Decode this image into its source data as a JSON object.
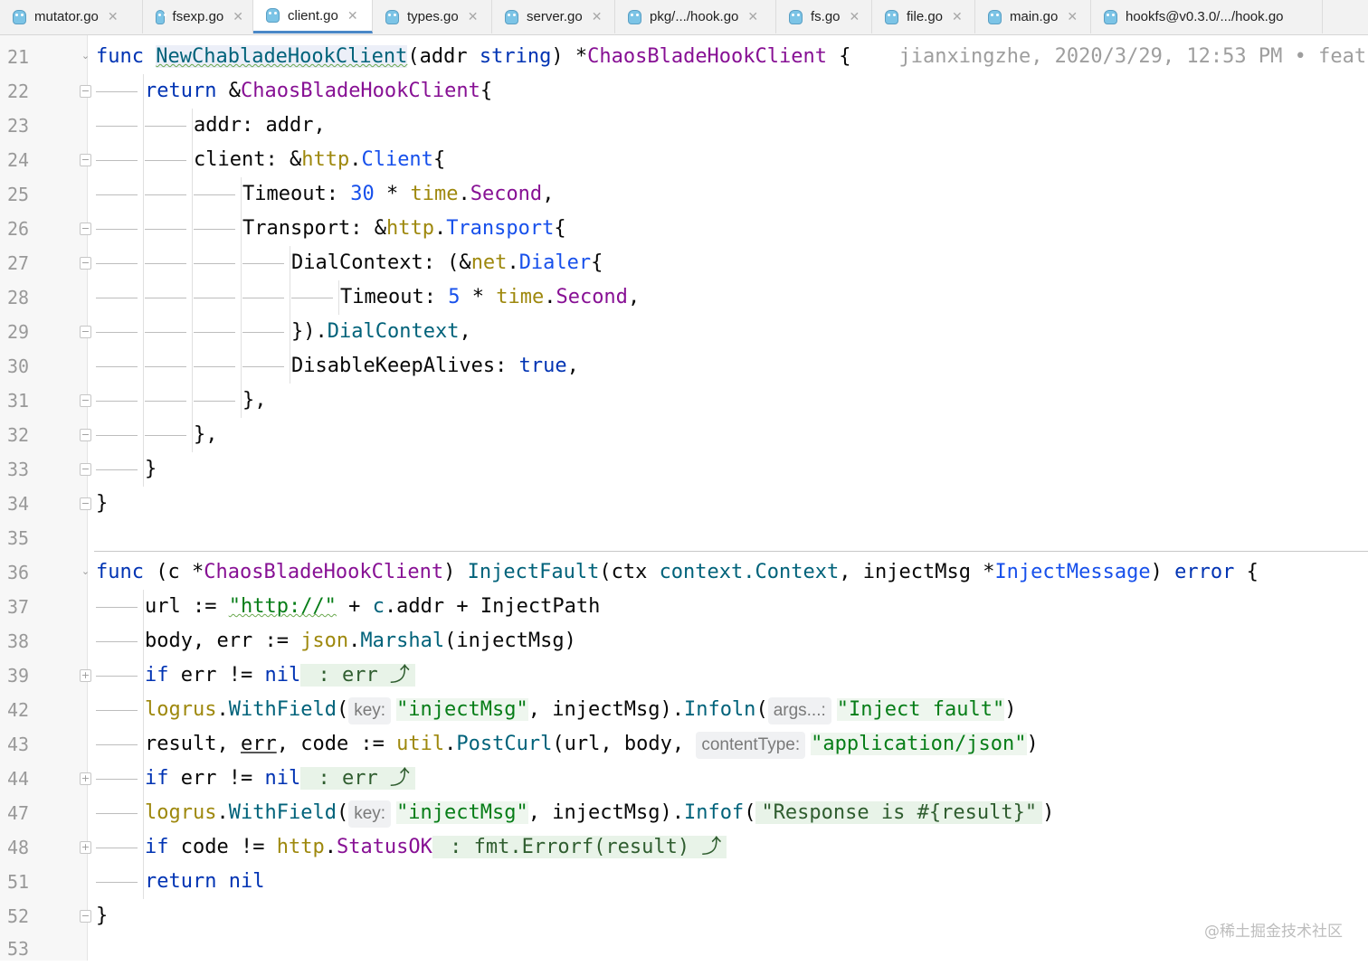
{
  "tabs": [
    {
      "label": "mutator.go",
      "active": false
    },
    {
      "label": "fsexp.go",
      "active": false
    },
    {
      "label": "client.go",
      "active": true
    },
    {
      "label": "types.go",
      "active": false
    },
    {
      "label": "server.go",
      "active": false
    },
    {
      "label": "pkg/.../hook.go",
      "active": false
    },
    {
      "label": "fs.go",
      "active": false
    },
    {
      "label": "file.go",
      "active": false
    },
    {
      "label": "main.go",
      "active": false
    },
    {
      "label": "hookfs@v0.3.0/.../hook.go",
      "active": false
    }
  ],
  "icons": {
    "tab_icon": "gopher-icon",
    "close": "close-icon",
    "fold": "fold-marker-icon"
  },
  "blame": "jianxingzhe, 2020/3/29, 12:53 PM • feat",
  "line_numbers": [
    "21",
    "22",
    "23",
    "24",
    "25",
    "26",
    "27",
    "28",
    "29",
    "30",
    "31",
    "32",
    "33",
    "34",
    "35",
    "36",
    "37",
    "38",
    "39",
    "42",
    "43",
    "44",
    "47",
    "48",
    "51",
    "52",
    "53"
  ],
  "code": {
    "l21": {
      "kw": "func",
      "name": "NewChabladeHookClient",
      "args": "(addr ",
      "argtype": "string",
      "rparen": ") *",
      "ret": "ChaosBladeHookClient",
      "brace": " {"
    },
    "l22": {
      "kw": "return",
      "amp": " &",
      "type": "ChaosBladeHookClient",
      "brace": "{"
    },
    "l23": {
      "text": "addr: addr,"
    },
    "l24": {
      "field": "client: &",
      "pkg": "http",
      "dot": ".",
      "type": "Client",
      "brace": "{"
    },
    "l25": {
      "field": "Timeout: ",
      "num": "30",
      "op": " * ",
      "pkg": "time",
      "dot": ".",
      "type": "Second",
      "comma": ","
    },
    "l26": {
      "field": "Transport: &",
      "pkg": "http",
      "dot": ".",
      "type": "Transport",
      "brace": "{"
    },
    "l27": {
      "field": "DialContext: (&",
      "pkg": "net",
      "dot": ".",
      "type": "Dialer",
      "brace": "{"
    },
    "l28": {
      "field": "Timeout: ",
      "num": "5",
      "op": " * ",
      "pkg": "time",
      "dot": ".",
      "type": "Second",
      "comma": ","
    },
    "l29": {
      "text": "}).",
      "method": "DialContext",
      "comma": ","
    },
    "l30": {
      "field": "DisableKeepAlives: ",
      "kw": "true",
      "comma": ","
    },
    "l31": {
      "text": "},"
    },
    "l32": {
      "text": "},"
    },
    "l33": {
      "text": "}"
    },
    "l34": {
      "text": "}"
    },
    "l36": {
      "kw": "func",
      "recv_open": " (c *",
      "recv_type": "ChaosBladeHookClient",
      "recv_close": ") ",
      "name": "InjectFault",
      "args": "(ctx ",
      "ctxtype": "context.Context",
      "sep": ", injectMsg *",
      "argtype": "InjectMessage",
      "rparen": ") ",
      "ret": "error",
      "brace": " {"
    },
    "l37": {
      "var": "url := ",
      "str": "\"http://\"",
      "rest1": " + ",
      "c": "c",
      "rest2": ".addr + InjectPath"
    },
    "l38": {
      "var": "body, err := ",
      "pkg": "json",
      "dot": ".",
      "method": "Marshal",
      "rest": "(injectMsg)"
    },
    "l39": {
      "kw": "if",
      "cond": " err != ",
      "nil": "nil",
      "fold": " : err ⤴"
    },
    "l42": {
      "pkg": "logrus",
      "dot": ".",
      "method": "WithField",
      "open": "(",
      "hint": "key:",
      "str": "\"injectMsg\"",
      "mid": ", injectMsg).",
      "method2": "Infoln",
      "open2": "(",
      "hint2": "args...:",
      "str2": "\"Inject fault\"",
      "close": ")"
    },
    "l43": {
      "var": "result, ",
      "err": "err",
      "mid": ", code := ",
      "pkg": "util",
      "dot": ".",
      "method": "PostCurl",
      "rest": "(url, body, ",
      "hint": "contentType:",
      "str": "\"application/json\"",
      "close": ")"
    },
    "l44": {
      "kw": "if",
      "cond": " err != ",
      "nil": "nil",
      "fold": " : err ⤴"
    },
    "l47": {
      "pkg": "logrus",
      "dot": ".",
      "method": "WithField",
      "open": "(",
      "hint": "key:",
      "str": "\"injectMsg\"",
      "mid": ", injectMsg).",
      "method2": "Infof",
      "open2": "(",
      "str2": "\"Response is #{result}\"",
      "close": ")"
    },
    "l48": {
      "kw": "if",
      "cond": " code != ",
      "pkg": "http",
      "dot": ".",
      "const": "StatusOK",
      "fold": " : fmt.Errorf(result) ⤴"
    },
    "l51": {
      "kw": "return",
      "nil": " nil"
    },
    "l52": {
      "text": "}"
    }
  },
  "watermark": "@稀土掘金技术社区"
}
